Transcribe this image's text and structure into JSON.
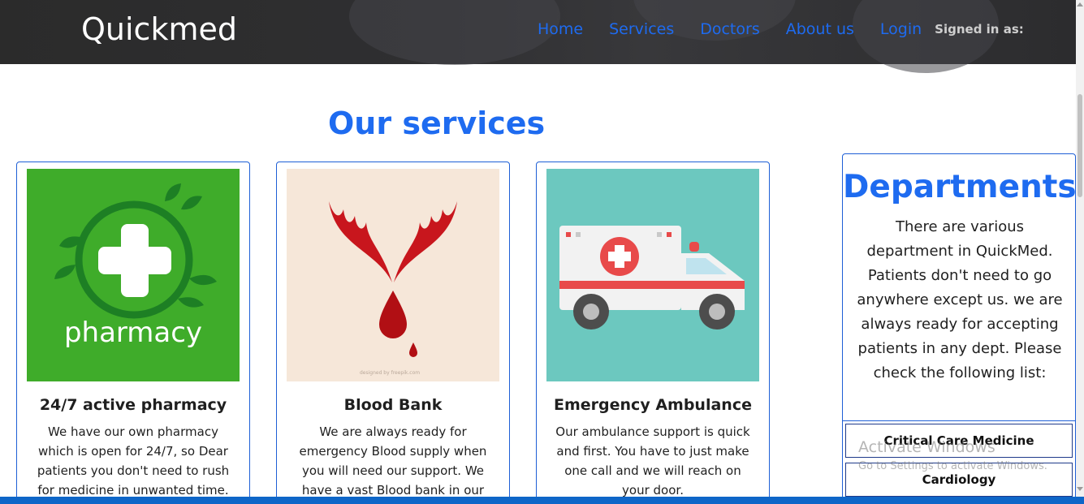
{
  "header": {
    "brand": "Quickmed",
    "nav": [
      "Home",
      "Services",
      "Doctors",
      "About us",
      "Login"
    ],
    "signed_in_label": "Signed in as:"
  },
  "services": {
    "title": "Our services",
    "cards": [
      {
        "title": "24/7 active pharmacy",
        "text": "We have our own pharmacy which is open for 24/7, so Dear patients you don't need to rush for medicine in unwanted time.",
        "image_label": "pharmacy",
        "image_icon": "pharmacy-cross-icon",
        "bg": "#3fac2a"
      },
      {
        "title": "Blood Bank",
        "text": "We are always ready for emergency Blood supply when you will need our support. We have a vast Blood bank in our",
        "image_credit": "designed by freepik.com",
        "image_icon": "blood-drop-hands-icon",
        "bg": "#f6e7d9"
      },
      {
        "title": "Emergency Ambulance",
        "text": "Our ambulance support is quick and first. You have to just make one call and we will reach on your door.",
        "image_icon": "ambulance-icon",
        "bg": "#6cc8bf"
      }
    ]
  },
  "departments": {
    "title": "Departments",
    "text": "There are various department in QuickMed. Patients don't need to go anywhere except us. we are always ready for accepting patients in any dept. Please check the following list:",
    "items": [
      "Critical Care Medicine",
      "Cardiology"
    ]
  },
  "watermark": {
    "title": "Activate Windows",
    "subtitle": "Go to Settings to activate Windows."
  },
  "colors": {
    "accent": "#1e6bf0",
    "border": "#1e5fd6",
    "navbar": "#2f2f31",
    "status_bar": "#0e66c8"
  }
}
